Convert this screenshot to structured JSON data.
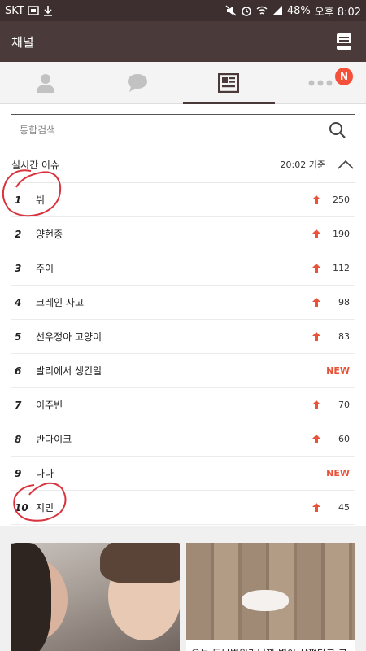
{
  "status_bar": {
    "carrier": "SKT",
    "battery": "48%",
    "time": "오후 8:02"
  },
  "header": {
    "title": "채널",
    "inbox_icon": "inbox-icon"
  },
  "tabs": [
    {
      "name": "friends",
      "icon": "person-icon"
    },
    {
      "name": "chats",
      "icon": "chat-bubble-icon"
    },
    {
      "name": "channel",
      "icon": "news-icon",
      "active": true
    },
    {
      "name": "more",
      "icon": "more-icon",
      "badge": "N"
    }
  ],
  "search": {
    "placeholder": "통합검색"
  },
  "realtime": {
    "title": "실시간 이슈",
    "time": "20:02",
    "time_suffix": "기준",
    "items": [
      {
        "rank": "1",
        "term": "뷔",
        "change": "250"
      },
      {
        "rank": "2",
        "term": "양현종",
        "change": "190"
      },
      {
        "rank": "3",
        "term": "주이",
        "change": "112"
      },
      {
        "rank": "4",
        "term": "크레인 사고",
        "change": "98"
      },
      {
        "rank": "5",
        "term": "선우정아 고양이",
        "change": "83"
      },
      {
        "rank": "6",
        "term": "발리에서 생긴일",
        "change": "NEW"
      },
      {
        "rank": "7",
        "term": "이주빈",
        "change": "70"
      },
      {
        "rank": "8",
        "term": "반다이크",
        "change": "60"
      },
      {
        "rank": "9",
        "term": "나나",
        "change": "NEW"
      },
      {
        "rank": "10",
        "term": "지민",
        "change": "45"
      }
    ]
  },
  "cards": [
    {
      "caption": ""
    },
    {
      "caption": "오늘 동물병원가니까 별이 살쪘다고 고"
    }
  ],
  "colors": {
    "status_bar": "#3d2f2f",
    "app_bar": "#4b3a3a",
    "accent_red": "#e8533a",
    "badge": "#f4513b"
  }
}
